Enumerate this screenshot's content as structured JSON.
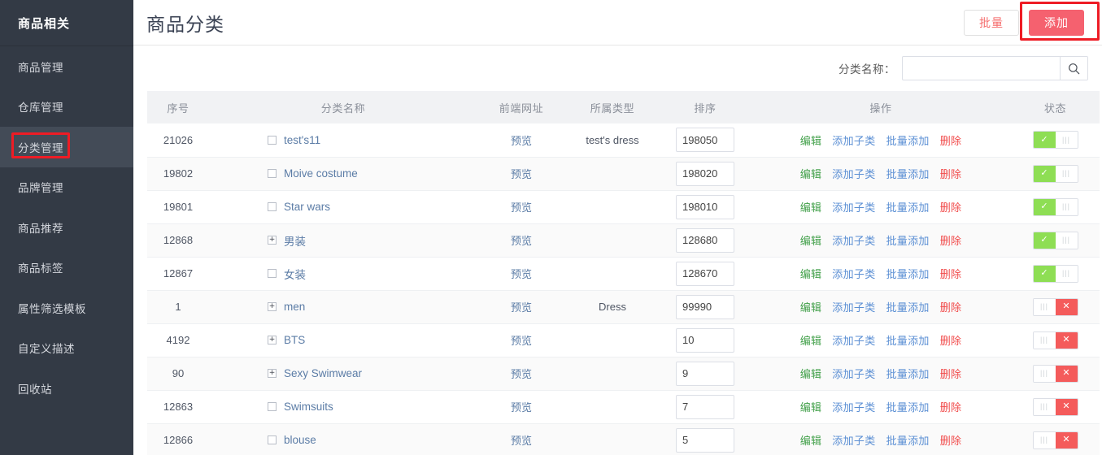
{
  "sidebar": {
    "brand": "商品相关",
    "items": [
      {
        "label": "商品管理",
        "active": false
      },
      {
        "label": "仓库管理",
        "active": false
      },
      {
        "label": "分类管理",
        "active": true
      },
      {
        "label": "品牌管理",
        "active": false
      },
      {
        "label": "商品推荐",
        "active": false
      },
      {
        "label": "商品标签",
        "active": false
      },
      {
        "label": "属性筛选模板",
        "active": false
      },
      {
        "label": "自定义描述",
        "active": false
      },
      {
        "label": "回收站",
        "active": false
      }
    ]
  },
  "header": {
    "title": "商品分类",
    "batch_label": "批量",
    "add_label": "添加",
    "add_button_color": "#f5616f",
    "annotation_color": "#ee1c25"
  },
  "filter": {
    "label": "分类名称：",
    "search_value": "",
    "search_placeholder": "",
    "search_icon": "search-icon"
  },
  "table": {
    "columns": [
      {
        "key": "id",
        "label": "序号"
      },
      {
        "key": "name",
        "label": "分类名称"
      },
      {
        "key": "url",
        "label": "前端网址"
      },
      {
        "key": "type",
        "label": "所属类型"
      },
      {
        "key": "sort",
        "label": "排序"
      },
      {
        "key": "ops",
        "label": "操作"
      },
      {
        "key": "status",
        "label": "状态"
      }
    ],
    "op_labels": {
      "edit": "编辑",
      "add_sub": "添加子类",
      "batch_add": "批量添加",
      "delete": "删除"
    },
    "preview_label": "预览",
    "op_colors": {
      "edit": "#42a04a",
      "add_sub": "#5b8fd4",
      "batch_add": "#5b8fd4",
      "delete": "#f14b4b"
    },
    "status_colors": {
      "on": "#8ede54",
      "off": "#f45b5b"
    },
    "rows": [
      {
        "id": "21026",
        "expandable": false,
        "name": "test's11",
        "url": "预览",
        "type": "test's dress",
        "sort": "198050",
        "status": "on"
      },
      {
        "id": "19802",
        "expandable": false,
        "name": "Moive costume",
        "url": "预览",
        "type": "",
        "sort": "198020",
        "status": "on"
      },
      {
        "id": "19801",
        "expandable": false,
        "name": "Star wars",
        "url": "预览",
        "type": "",
        "sort": "198010",
        "status": "on"
      },
      {
        "id": "12868",
        "expandable": true,
        "name": "男装",
        "url": "预览",
        "type": "",
        "sort": "128680",
        "status": "on"
      },
      {
        "id": "12867",
        "expandable": false,
        "name": "女装",
        "url": "预览",
        "type": "",
        "sort": "128670",
        "status": "on"
      },
      {
        "id": "1",
        "expandable": true,
        "name": "men",
        "url": "预览",
        "type": "Dress",
        "sort": "99990",
        "status": "off"
      },
      {
        "id": "4192",
        "expandable": true,
        "name": "BTS",
        "url": "预览",
        "type": "",
        "sort": "10",
        "status": "off"
      },
      {
        "id": "90",
        "expandable": true,
        "name": "Sexy Swimwear",
        "url": "预览",
        "type": "",
        "sort": "9",
        "status": "off"
      },
      {
        "id": "12863",
        "expandable": false,
        "name": "Swimsuits",
        "url": "预览",
        "type": "",
        "sort": "7",
        "status": "off"
      },
      {
        "id": "12866",
        "expandable": false,
        "name": "blouse",
        "url": "预览",
        "type": "",
        "sort": "5",
        "status": "off"
      }
    ]
  }
}
